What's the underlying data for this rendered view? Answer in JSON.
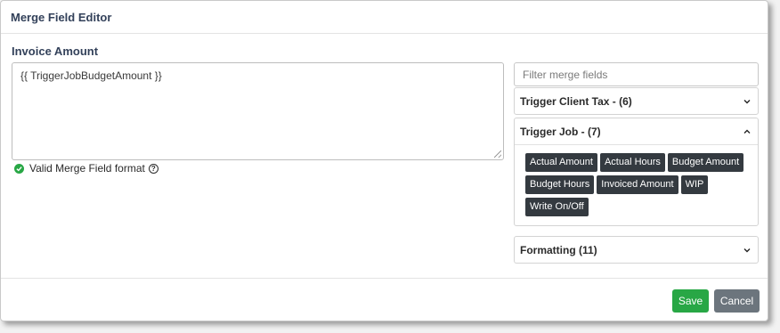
{
  "dialog": {
    "title": "Merge Field Editor"
  },
  "editor": {
    "label": "Invoice Amount",
    "value": "{{ TriggerJobBudgetAmount }}",
    "validation_text": "Valid Merge Field format",
    "validation_color": "#28a745"
  },
  "filter": {
    "placeholder": "Filter merge fields",
    "value": ""
  },
  "groups": [
    {
      "title": "Trigger Client Tax - (6)",
      "expanded": false
    },
    {
      "title": "Trigger Job - (7)",
      "expanded": true,
      "fields": [
        "Actual Amount",
        "Actual Hours",
        "Budget Amount",
        "Budget Hours",
        "Invoiced Amount",
        "WIP",
        "Write On/Off"
      ]
    },
    {
      "title": "Formatting (11)",
      "expanded": false
    }
  ],
  "footer": {
    "save_label": "Save",
    "cancel_label": "Cancel"
  },
  "colors": {
    "primary_text": "#33415a",
    "chip_bg": "#343a40",
    "save": "#28a745",
    "cancel": "#6c757d"
  }
}
